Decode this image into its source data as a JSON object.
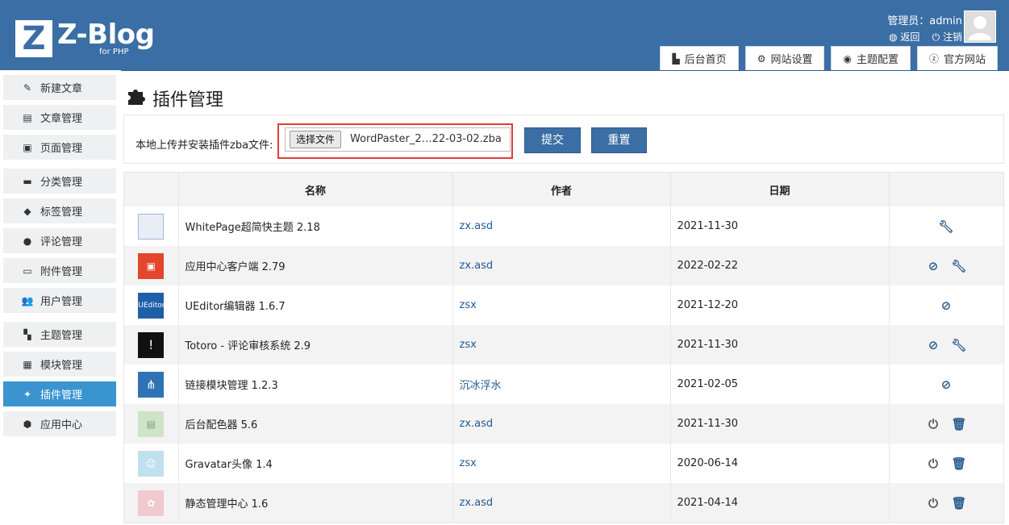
{
  "header": {
    "logo_letter": "Z",
    "logo_text": "Z-Blog",
    "logo_sub": "for PHP",
    "user_label": "管理员：admin",
    "back_label": "返回",
    "logout_label": "注销",
    "tabs": [
      {
        "label": "后台首页",
        "icon": "home-icon"
      },
      {
        "label": "网站设置",
        "icon": "gear-icon"
      },
      {
        "label": "主题配置",
        "icon": "palette-icon"
      },
      {
        "label": "官方网站",
        "icon": "zblog-icon"
      }
    ]
  },
  "sidebar": {
    "items": [
      {
        "label": "新建文章",
        "icon": "edit-icon"
      },
      {
        "label": "文章管理",
        "icon": "article-icon"
      },
      {
        "label": "页面管理",
        "icon": "page-icon"
      },
      {
        "label": "分类管理",
        "icon": "folder-icon"
      },
      {
        "label": "标签管理",
        "icon": "tag-icon"
      },
      {
        "label": "评论管理",
        "icon": "comment-icon"
      },
      {
        "label": "附件管理",
        "icon": "attachment-icon"
      },
      {
        "label": "用户管理",
        "icon": "users-icon"
      },
      {
        "label": "主题管理",
        "icon": "theme-icon"
      },
      {
        "label": "模块管理",
        "icon": "module-icon"
      },
      {
        "label": "插件管理",
        "icon": "puzzle-icon",
        "active": true
      },
      {
        "label": "应用中心",
        "icon": "app-icon"
      }
    ]
  },
  "page": {
    "title": "插件管理",
    "upload_label": "本地上传并安装插件zba文件:",
    "file_button": "选择文件",
    "file_name": "WordPaster_2…22-03-02.zba",
    "submit_label": "提交",
    "reset_label": "重置"
  },
  "table": {
    "headers": [
      "",
      "名称",
      "作者",
      "日期",
      ""
    ],
    "rows": [
      {
        "name": "WhitePage超简快主题 2.18",
        "author": "zx.asd",
        "date": "2021-11-30",
        "actions": [
          "settings"
        ],
        "icon_color": "#e9eef5"
      },
      {
        "name": "应用中心客户端 2.79",
        "author": "zx.asd",
        "date": "2022-02-22",
        "actions": [
          "disable",
          "settings"
        ],
        "icon_color": "#e3462a"
      },
      {
        "name": "UEditor编辑器 1.6.7",
        "author": "zsx",
        "date": "2021-12-20",
        "actions": [
          "disable"
        ],
        "icon_color": "#1e5fa8"
      },
      {
        "name": "Totoro - 评论审核系统 2.9",
        "author": "zsx",
        "date": "2021-11-30",
        "actions": [
          "disable",
          "settings"
        ],
        "icon_color": "#111111"
      },
      {
        "name": "链接模块管理 1.2.3",
        "author": "沉冰浮水",
        "date": "2021-02-05",
        "actions": [
          "disable"
        ],
        "icon_color": "#2f73b5"
      },
      {
        "name": "后台配色器 5.6",
        "author": "zx.asd",
        "date": "2021-11-30",
        "actions": [
          "enable",
          "delete"
        ],
        "icon_color": "#cfe3c8"
      },
      {
        "name": "Gravatar头像 1.4",
        "author": "zsx",
        "date": "2020-06-14",
        "actions": [
          "enable",
          "delete"
        ],
        "icon_color": "#bfe0ee"
      },
      {
        "name": "静态管理中心 1.6",
        "author": "zx.asd",
        "date": "2021-04-14",
        "actions": [
          "enable",
          "delete"
        ],
        "icon_color": "#f1c9cf"
      }
    ]
  }
}
